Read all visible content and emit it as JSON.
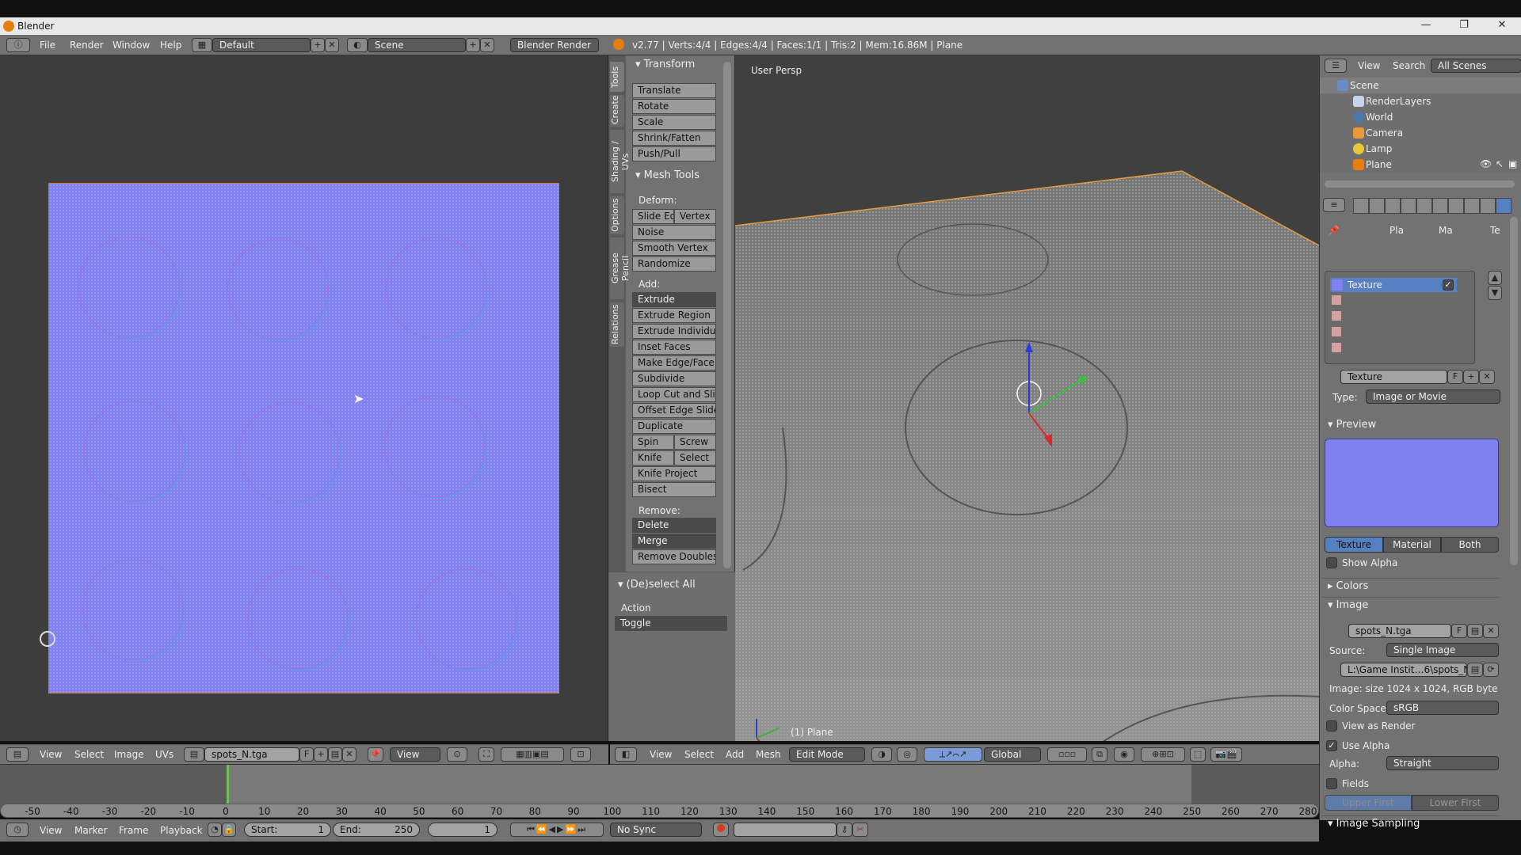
{
  "window": {
    "title": "Blender",
    "minimize": "—",
    "maximize": "❐",
    "close": "✕"
  },
  "top_header": {
    "menus": [
      "File",
      "Render",
      "Window",
      "Help"
    ],
    "layout": "Default",
    "scene": "Scene",
    "render_engine": "Blender Render",
    "stats": "v2.77 | Verts:4/4 | Edges:4/4 | Faces:1/1 | Tris:2 | Mem:16.86M | Plane"
  },
  "uv_editor": {
    "header": {
      "menus": [
        "View",
        "Select",
        "Image",
        "UVs"
      ],
      "image_name": "spots_N.tga",
      "fake_user": "F",
      "view_mode": "View"
    },
    "image_color": "#8080ee"
  },
  "tool_shelf": {
    "tabs": [
      "Tools",
      "Create",
      "Shading / UVs",
      "Options",
      "Grease Pencil",
      "Relations"
    ],
    "transform": {
      "title": "Transform",
      "buttons": [
        "Translate",
        "Rotate",
        "Scale",
        "Shrink/Fatten",
        "Push/Pull"
      ]
    },
    "mesh_tools": {
      "title": "Mesh Tools",
      "deform_label": "Deform:",
      "deform": [
        "Slide Ed",
        "Vertex",
        "Noise",
        "Smooth Vertex",
        "Randomize"
      ],
      "add_label": "Add:",
      "add": [
        "Extrude",
        "Extrude Region",
        "Extrude Individual",
        "Inset Faces",
        "Make Edge/Face",
        "Subdivide",
        "Loop Cut and Slide",
        "Offset Edge Slide",
        "Duplicate",
        "Spin",
        "Screw",
        "Knife",
        "Select",
        "Knife Project",
        "Bisect"
      ],
      "remove_label": "Remove:",
      "remove": [
        "Delete",
        "Merge",
        "Remove Doubles"
      ]
    },
    "operator": {
      "title": "(De)select All",
      "action_label": "Action",
      "action_value": "Toggle"
    }
  },
  "viewport": {
    "view_name": "User Persp",
    "object_info": "(1) Plane",
    "header": {
      "menus": [
        "View",
        "Select",
        "Add",
        "Mesh"
      ],
      "mode": "Edit Mode",
      "orientation": "Global"
    }
  },
  "outliner": {
    "header": {
      "view": "View",
      "search": "Search",
      "filter": "All Scenes"
    },
    "items": [
      {
        "label": "Scene",
        "icon": "scene-icon"
      },
      {
        "label": "RenderLayers",
        "icon": "render-layers-icon"
      },
      {
        "label": "World",
        "icon": "world-icon"
      },
      {
        "label": "Camera",
        "icon": "camera-icon"
      },
      {
        "label": "Lamp",
        "icon": "lamp-icon"
      },
      {
        "label": "Plane",
        "icon": "mesh-icon"
      }
    ]
  },
  "properties": {
    "breadcrumb": [
      "Pla",
      "Ma",
      "Te"
    ],
    "texture_slots": [
      "Texture",
      "",
      "",
      "",
      ""
    ],
    "texture_name": "Texture",
    "fake_user": "F",
    "type_label": "Type:",
    "type_value": "Image or Movie",
    "preview": {
      "title": "Preview",
      "tabs": [
        "Texture",
        "Material",
        "Both"
      ],
      "active_tab": "Texture",
      "show_alpha": "Show Alpha"
    },
    "colors_title": "Colors",
    "image": {
      "title": "Image",
      "name": "spots_N.tga",
      "source_label": "Source:",
      "source_value": "Single Image",
      "path": "L:\\Game Instit…6\\spots_N.tga",
      "info": "Image: size 1024 x 1024, RGB byte",
      "color_space_label": "Color Space:",
      "color_space_value": "sRGB",
      "view_as_render": "View as Render",
      "use_alpha": "Use Alpha",
      "alpha_label": "Alpha:",
      "alpha_value": "Straight",
      "fields": "Fields",
      "field_order": [
        "Upper First",
        "Lower First"
      ]
    },
    "image_sampling_title": "Image Sampling"
  },
  "timeline": {
    "ticks": [
      "-50",
      "-40",
      "-30",
      "-20",
      "-10",
      "0",
      "10",
      "20",
      "30",
      "40",
      "50",
      "60",
      "70",
      "80",
      "90",
      "100",
      "110",
      "120",
      "130",
      "140",
      "150",
      "160",
      "170",
      "180",
      "190",
      "200",
      "210",
      "220",
      "230",
      "240",
      "250",
      "260",
      "270",
      "280"
    ],
    "header": {
      "menus": [
        "View",
        "Marker",
        "Frame",
        "Playback"
      ],
      "start_label": "Start:",
      "start": "1",
      "end_label": "End:",
      "end": "250",
      "current": "1",
      "sync": "No Sync"
    }
  }
}
